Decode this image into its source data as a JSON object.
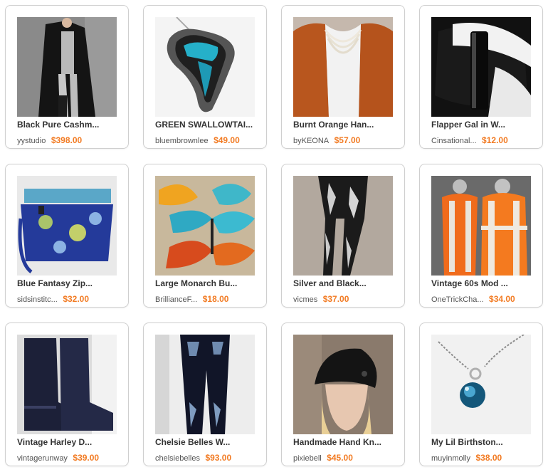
{
  "items": [
    {
      "title": "Black Pure Cashm...",
      "shop": "yystudio",
      "price": "$398.00",
      "image": "black cashmere coat on model"
    },
    {
      "title": "GREEN SWALLOWTAI...",
      "shop": "bluembrownlee",
      "price": "$49.00",
      "image": "swallowtail butterfly wing pendant"
    },
    {
      "title": "Burnt Orange Han...",
      "shop": "byKEONA",
      "price": "$57.00",
      "image": "orange knit shrug with pearls"
    },
    {
      "title": "Flapper Gal in W...",
      "shop": "Cinsational...",
      "price": "$12.00",
      "image": "white leather cuff with black buckle"
    },
    {
      "title": "Blue Fantasy Zip...",
      "shop": "sidsinstitc...",
      "price": "$32.00",
      "image": "blue floral zip bag"
    },
    {
      "title": "Large Monarch Bu...",
      "shop": "BrillianceF...",
      "price": "$18.00",
      "image": "paper butterflies"
    },
    {
      "title": "Silver and Black...",
      "shop": "vicmes",
      "price": "$37.00",
      "image": "silver and black leggings"
    },
    {
      "title": "Vintage 60s Mod ...",
      "shop": "OneTrickCha...",
      "price": "$34.00",
      "image": "orange striped cardigans on mannequins"
    },
    {
      "title": "Vintage Harley D...",
      "shop": "vintagerunway",
      "price": "$39.00",
      "image": "black leather boots"
    },
    {
      "title": "Chelsie Belles W...",
      "shop": "chelsiebelles",
      "price": "$93.00",
      "image": "embroidered dark jeans"
    },
    {
      "title": "Handmade Hand Kn...",
      "shop": "pixiebell",
      "price": "$45.00",
      "image": "black knit beret on model"
    },
    {
      "title": "My Lil Birthston...",
      "shop": "muyinmolly",
      "price": "$38.00",
      "image": "blue birthstone pendant necklace"
    }
  ]
}
